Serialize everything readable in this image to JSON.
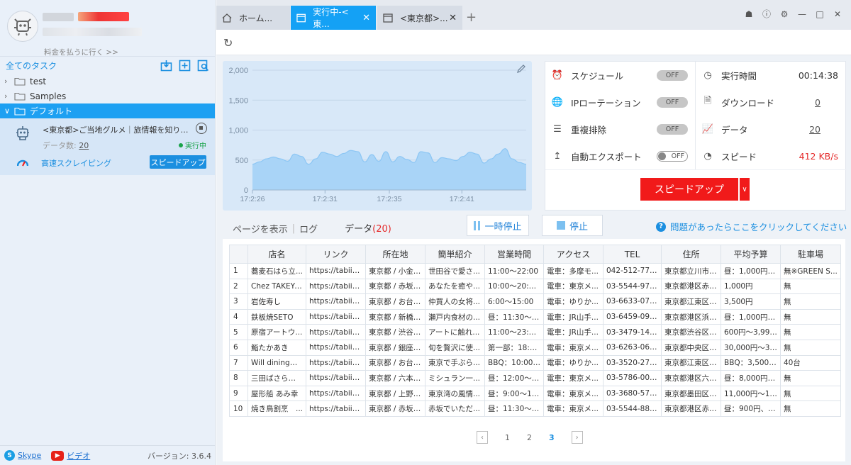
{
  "sidebar": {
    "pay_link": "料金を払うに行く >>",
    "tasks_header": "全てのタスク",
    "folders": [
      {
        "label": "test"
      },
      {
        "label": "Samples"
      },
      {
        "label": "デフォルト"
      }
    ],
    "task": {
      "name": "<東京都>ご当地グルメ｜旅情報を知り尽...",
      "count_label": "データ数:",
      "count_value": "20",
      "status": "実行中",
      "mode": "高速スクレイピング",
      "speed_button": "スピードアップ"
    },
    "footer": {
      "skype": "Skype",
      "video": "ビデオ",
      "version": "バージョン: 3.6.4"
    }
  },
  "tabs": [
    {
      "label": "ホーム..."
    },
    {
      "label": "実行中-<東..."
    },
    {
      "label": "<東京都>..."
    }
  ],
  "chart_data": {
    "type": "area",
    "x_ticks": [
      "17:2:26",
      "17:2:31",
      "17:2:35",
      "17:2:41"
    ],
    "y_ticks": [
      "2,000",
      "1,500",
      "1,000",
      "500",
      "0"
    ],
    "ylim": [
      0,
      2000
    ],
    "values": [
      430,
      470,
      520,
      550,
      520,
      480,
      600,
      560,
      430,
      520,
      630,
      600,
      560,
      610,
      660,
      640,
      470,
      590,
      480,
      640,
      470,
      560,
      510,
      460,
      640,
      620,
      460,
      540,
      520,
      490,
      560,
      630,
      600,
      450,
      520,
      600,
      690,
      520,
      460,
      430
    ]
  },
  "stats": {
    "schedule": {
      "label": "スケジュール",
      "toggle": "OFF"
    },
    "ip_rotation": {
      "label": "IPローテーション",
      "toggle": "OFF"
    },
    "dedupe": {
      "label": "重複排除",
      "toggle": "OFF"
    },
    "auto_export": {
      "label": "自動エクスポート",
      "toggle": "OFF"
    },
    "run_time": {
      "label": "実行時間",
      "value": "00:14:38"
    },
    "download": {
      "label": "ダウンロード",
      "value": "0"
    },
    "data": {
      "label": "データ",
      "value": "20"
    },
    "speed": {
      "label": "スピード",
      "value": "412 KB/s"
    },
    "speed_up_button": "スピードアップ"
  },
  "subtabs": {
    "show_page": "ページを表示",
    "log": "ログ",
    "data": "データ",
    "data_count": "(20)"
  },
  "controls": {
    "pause": "一時停止",
    "stop": "停止",
    "help": "問題があったらここをクリックしてください"
  },
  "table": {
    "headers": [
      "",
      "店名",
      "リンク",
      "所在地",
      "簡単紹介",
      "営業時間",
      "アクセス",
      "TEL",
      "住所",
      "平均予算",
      "駐車場"
    ],
    "rows": [
      [
        "1",
        "蕎麦石はら立...",
        "https://tabiiro.j...",
        "東京都 / 小金井...",
        "世田谷で愛さ...",
        "11:00～22:00",
        "電車：多摩モ...",
        "042-512-7751",
        "東京都立川市緑...",
        "昼：1,000円～...",
        "無※GREEN S..."
      ],
      [
        "2",
        "Chez TAKEYA...",
        "https://tabiiro.j...",
        "東京都 / 赤坂・...",
        "あなたを癒や...",
        "10:00～20:00...",
        "電車：東京メ...",
        "03-5544-9730",
        "東京都港区赤坂...",
        "1,000円",
        "無"
      ],
      [
        "3",
        "岩佐寿し",
        "https://tabiiro.j...",
        "東京都 / お台場...",
        "仲買人の女将...",
        "6:00～15:00",
        "電車：ゆりか...",
        "03-6633-0755",
        "東京都江東区豊...",
        "3,500円",
        "無"
      ],
      [
        "4",
        "鉄板焼SETO",
        "https://tabiiro.j...",
        "東京都 / 新橋・...",
        "瀬戸内食材の...",
        "昼：11:30～14...",
        "電車：JR山手...",
        "03-6459-0929",
        "東京都港区浜松...",
        "昼：1,000円～...",
        "無"
      ],
      [
        "5",
        "原宿アートウ...",
        "https://tabiiro.j...",
        "東京都 / 渋谷・...",
        "アートに触れ...",
        "11:00～23:00...",
        "電車：JR山手...",
        "03-3479-1442",
        "東京都渋谷区神...",
        "600円～3,999円",
        "無"
      ],
      [
        "6",
        "鮨たかあき",
        "https://tabiiro.j...",
        "東京都 / 銀座・...",
        "旬を贅沢に使...",
        "第一部：18:00...",
        "電車：東京メ...",
        "03-6263-0627",
        "東京都中央区銀...",
        "30,000円～39,...",
        "無"
      ],
      [
        "7",
        "Will dining＆B...",
        "https://tabiiro.j...",
        "東京都 / お台場...",
        "東京で手ぶら...",
        "BBQ：10:00～...",
        "電車：ゆりか...",
        "03-3520-2760",
        "東京都江東区有...",
        "BBQ：3,500円...",
        "40台"
      ],
      [
        "8",
        "三田ばさら別邸",
        "https://tabiiro.j...",
        "東京都 / 六本木...",
        "ミシュラン一...",
        "昼：12:00～15...",
        "電車：東京メ...",
        "03-5786-0011",
        "東京都港区六本...",
        "昼：8,000円～...",
        "無"
      ],
      [
        "9",
        "屋形船 あみ幸",
        "https://tabiiro.j...",
        "東京都 / 上野・...",
        "東京湾の風情...",
        "昼：9:00～15:...",
        "電車：東京メ...",
        "03-3680-5755",
        "東京都墨田区吾...",
        "11,000円～15,...",
        "無"
      ],
      [
        "10",
        "焼き鳥割烹　...",
        "https://tabiiro.j...",
        "東京都 / 赤坂・...",
        "赤坂でいただ...",
        "昼：11:30～17...",
        "電車：東京メ...",
        "03-5544-8818",
        "東京都港区赤坂...",
        "昼：900円、夜...",
        "無"
      ]
    ]
  },
  "pager": {
    "pages": [
      "1",
      "2",
      "3"
    ],
    "current": "3"
  },
  "colors": {
    "accent": "#14a1f5",
    "danger": "#f11a1a",
    "sidebar_bg": "#e9f0f9"
  },
  "icons": {
    "home": "home-icon",
    "refresh": "refresh-icon",
    "edit": "pencil-icon"
  }
}
